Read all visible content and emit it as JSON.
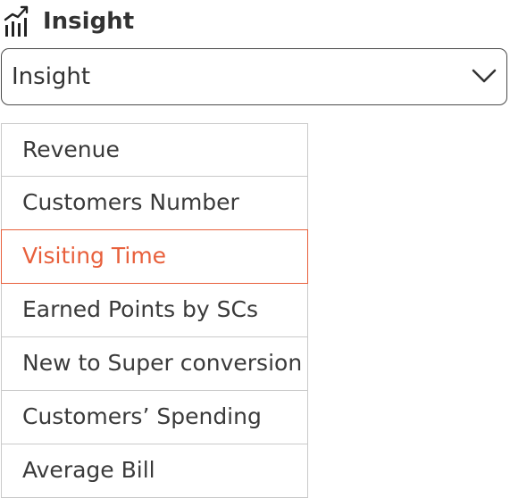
{
  "header": {
    "icon": "bar-chart-trend-icon",
    "title": "Insight"
  },
  "select": {
    "value": "Insight",
    "icon": "chevron-down-icon"
  },
  "options": [
    {
      "label": "Revenue",
      "selected": false
    },
    {
      "label": "Customers Number",
      "selected": false
    },
    {
      "label": "Visiting Time",
      "selected": true
    },
    {
      "label": "Earned Points by SCs",
      "selected": false
    },
    {
      "label": "New to Super conversion",
      "selected": false
    },
    {
      "label": "Customers’ Spending",
      "selected": false
    },
    {
      "label": "Average Bill",
      "selected": false
    }
  ],
  "colors": {
    "accent": "#e8603c",
    "text": "#333333",
    "border": "#c9c9c9"
  }
}
